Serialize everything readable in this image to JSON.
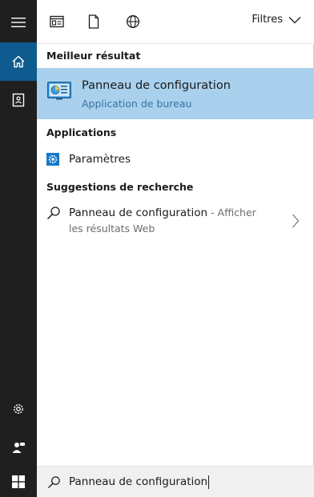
{
  "toolbar": {
    "filters_label": "Filtres"
  },
  "sections": {
    "best_match_title": "Meilleur résultat",
    "apps_title": "Applications",
    "suggestions_title": "Suggestions de recherche"
  },
  "best_match": {
    "title": "Panneau de configuration",
    "subtitle": "Application de bureau"
  },
  "apps": [
    {
      "label": "Paramètres",
      "icon": "gear-icon"
    }
  ],
  "suggestions": [
    {
      "query": "Panneau de configuration",
      "hint": " - Afficher les résultats Web"
    }
  ],
  "search": {
    "value": "Panneau de configuration"
  },
  "colors": {
    "rail_bg": "#1f1f1f",
    "rail_active": "#0f5a8f",
    "selection": "#a9d1ee",
    "subtitle_blue": "#3b6fa0",
    "search_bg": "#f0f0f0"
  }
}
